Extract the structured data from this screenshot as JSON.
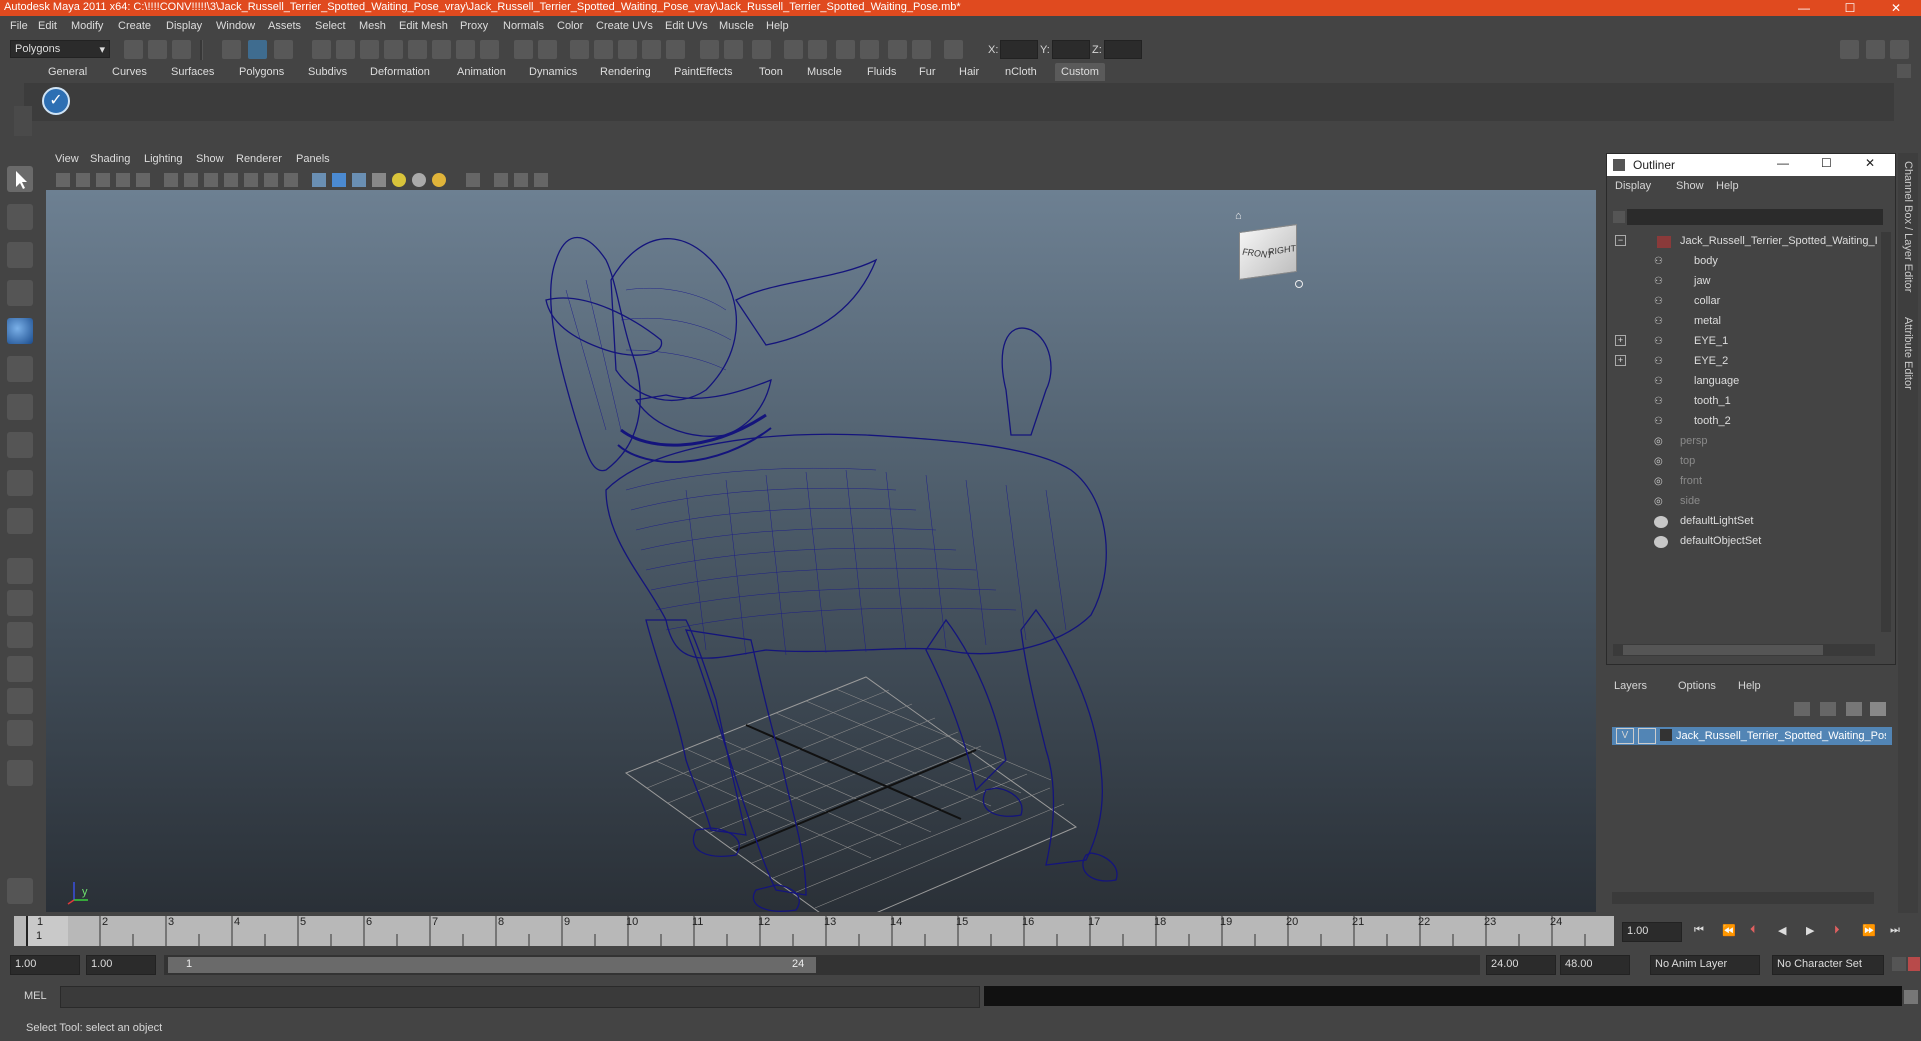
{
  "window": {
    "title": "Autodesk Maya 2011 x64: C:\\!!!!CONV!!!!!\\3\\Jack_Russell_Terrier_Spotted_Waiting_Pose_vray\\Jack_Russell_Terrier_Spotted_Waiting_Pose_vray\\Jack_Russell_Terrier_Spotted_Waiting_Pose.mb*",
    "minimize": "—",
    "maximize": "☐",
    "close": "✕"
  },
  "menubar": [
    "File",
    "Edit",
    "Modify",
    "Create",
    "Display",
    "Window",
    "Assets",
    "Select",
    "Mesh",
    "Edit Mesh",
    "Proxy",
    "Normals",
    "Color",
    "Create UVs",
    "Edit UVs",
    "Muscle",
    "Help"
  ],
  "status": {
    "mode": "Polygons",
    "x_label": "X:",
    "y_label": "Y:",
    "z_label": "Z:"
  },
  "shelf_tabs": [
    "General",
    "Curves",
    "Surfaces",
    "Polygons",
    "Subdivs",
    "Deformation",
    "Animation",
    "Dynamics",
    "Rendering",
    "PaintEffects",
    "Toon",
    "Muscle",
    "Fluids",
    "Fur",
    "Hair",
    "nCloth",
    "Custom"
  ],
  "shelf_active": "Custom",
  "viewport": {
    "menu": [
      "View",
      "Shading",
      "Lighting",
      "Show",
      "Renderer",
      "Panels"
    ],
    "viewcube_front": "FRONT",
    "viewcube_right": "RIGHT",
    "axis_y": "y"
  },
  "outliner": {
    "title": "Outliner",
    "menu": [
      "Display",
      "Show",
      "Help"
    ],
    "items": [
      {
        "label": "Jack_Russell_Terrier_Spotted_Waiting_I",
        "dim": false
      },
      {
        "label": "body",
        "dim": false
      },
      {
        "label": "jaw",
        "dim": false
      },
      {
        "label": "collar",
        "dim": false
      },
      {
        "label": "metal",
        "dim": false
      },
      {
        "label": "EYE_1",
        "dim": false
      },
      {
        "label": "EYE_2",
        "dim": false
      },
      {
        "label": "language",
        "dim": false
      },
      {
        "label": "tooth_1",
        "dim": false
      },
      {
        "label": "tooth_2",
        "dim": false
      },
      {
        "label": "persp",
        "dim": true
      },
      {
        "label": "top",
        "dim": true
      },
      {
        "label": "front",
        "dim": true
      },
      {
        "label": "side",
        "dim": true
      },
      {
        "label": "defaultLightSet",
        "dim": false
      },
      {
        "label": "defaultObjectSet",
        "dim": false
      }
    ]
  },
  "layers": {
    "menu": [
      "Layers",
      "Options",
      "Help"
    ],
    "row_visibility": "V",
    "row_name": "Jack_Russell_Terrier_Spotted_Waiting_Pose"
  },
  "side_tabs": {
    "channel_box": "Channel Box / Layer Editor",
    "attribute_editor": "Attribute Editor"
  },
  "timeline": {
    "ticks": [
      "1",
      "2",
      "3",
      "4",
      "5",
      "6",
      "7",
      "8",
      "9",
      "10",
      "11",
      "12",
      "13",
      "14",
      "15",
      "16",
      "17",
      "18",
      "19",
      "20",
      "21",
      "22",
      "23",
      "24"
    ],
    "current_frame_label": "1",
    "current_time": "1.00"
  },
  "range": {
    "start": "1.00",
    "anim_start": "1.00",
    "range_start": "1",
    "range_end": "24",
    "anim_end": "24.00",
    "end": "48.00",
    "anim_layer": "No Anim Layer",
    "character_set": "No Character Set"
  },
  "command": {
    "label": "MEL"
  },
  "help": {
    "text": "Select Tool: select an object"
  }
}
